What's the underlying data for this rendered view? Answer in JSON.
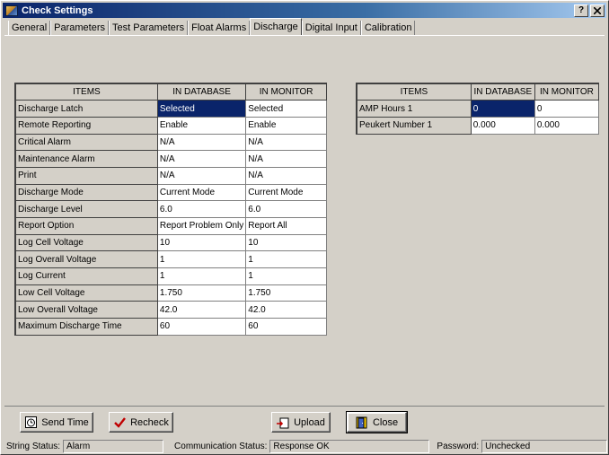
{
  "window": {
    "title": "Check Settings",
    "buttons": {
      "help": "?",
      "close": "✕"
    }
  },
  "tabs": [
    {
      "label": "General"
    },
    {
      "label": "Parameters"
    },
    {
      "label": "Test Parameters"
    },
    {
      "label": "Float Alarms"
    },
    {
      "label": "Discharge",
      "active": true
    },
    {
      "label": "Digital Input"
    },
    {
      "label": "Calibration"
    }
  ],
  "left_table": {
    "headers": [
      "ITEMS",
      "IN DATABASE",
      "IN MONITOR"
    ],
    "rows": [
      {
        "item": "Discharge Latch",
        "db": "Selected",
        "mon": "Selected"
      },
      {
        "item": "Remote Reporting",
        "db": "Enable",
        "mon": "Enable"
      },
      {
        "item": "Critical Alarm",
        "db": "N/A",
        "mon": "N/A"
      },
      {
        "item": "Maintenance Alarm",
        "db": "N/A",
        "mon": "N/A"
      },
      {
        "item": "Print",
        "db": "N/A",
        "mon": "N/A"
      },
      {
        "item": "Discharge Mode",
        "db": "Current Mode",
        "mon": "Current Mode"
      },
      {
        "item": "Discharge Level",
        "db": "6.0",
        "mon": "6.0"
      },
      {
        "item": "Report Option",
        "db": "Report Problem Only",
        "mon": "Report All"
      },
      {
        "item": "Log Cell Voltage",
        "db": "10",
        "mon": "10"
      },
      {
        "item": "Log Overall Voltage",
        "db": "1",
        "mon": "1"
      },
      {
        "item": "Log Current",
        "db": "1",
        "mon": "1"
      },
      {
        "item": "Low Cell Voltage",
        "db": " 1.750",
        "mon": " 1.750"
      },
      {
        "item": "Low Overall Voltage",
        "db": "42.0",
        "mon": "42.0"
      },
      {
        "item": "Maximum Discharge Time",
        "db": "60",
        "mon": "60"
      }
    ]
  },
  "right_table": {
    "headers": [
      "ITEMS",
      "IN DATABASE",
      "IN MONITOR"
    ],
    "rows": [
      {
        "item": "AMP Hours 1",
        "db": "0",
        "mon": "0"
      },
      {
        "item": "Peukert Number 1",
        "db": "0.000",
        "mon": "0.000"
      }
    ]
  },
  "buttons": {
    "send_time": "Send Time",
    "recheck": "Recheck",
    "upload": "Upload",
    "close": "Close"
  },
  "status": {
    "string_label": "String Status:",
    "string_value": "Alarm",
    "comm_label": "Communication Status:",
    "comm_value": "Response OK",
    "password_label": "Password:",
    "password_value": "Unchecked"
  },
  "colors": {
    "selection": "#0a246a",
    "face": "#d4d0c8"
  }
}
